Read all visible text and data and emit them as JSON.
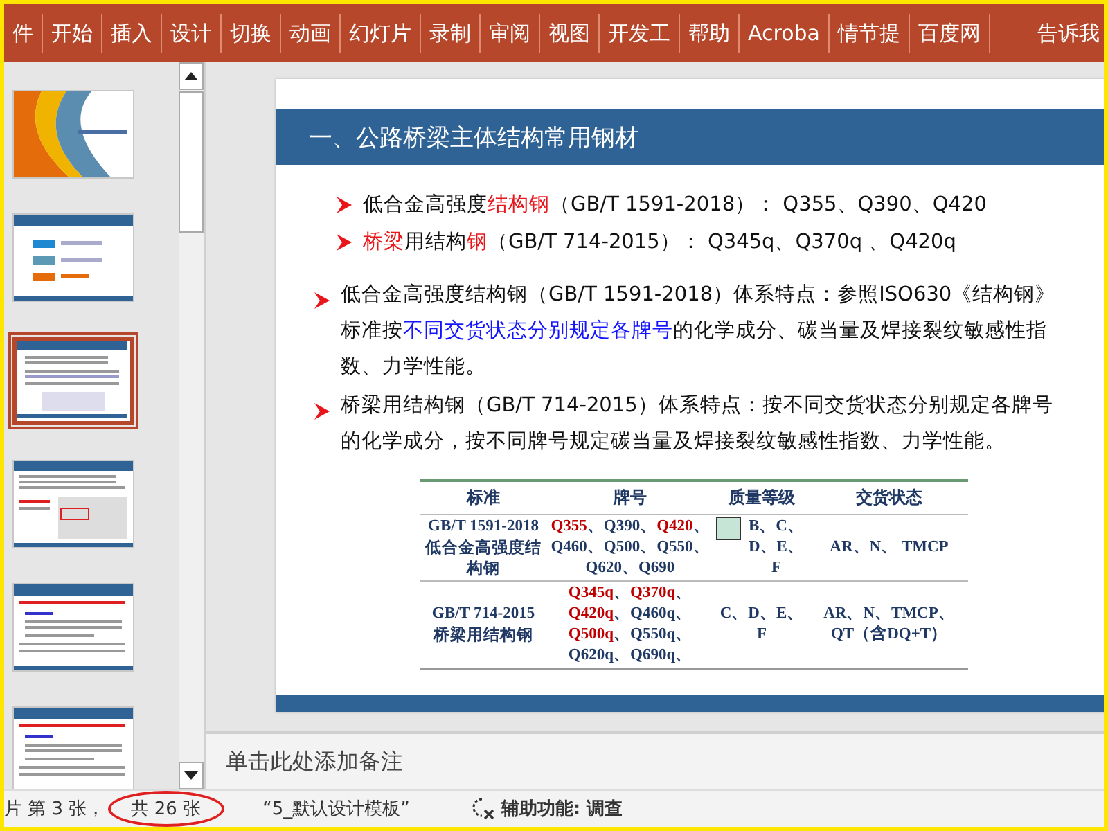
{
  "ribbon": {
    "tabs": [
      {
        "label": "件",
        "selected": false
      },
      {
        "label": "开始",
        "selected": false
      },
      {
        "label": "插入",
        "selected": false
      },
      {
        "label": "设计",
        "selected": false
      },
      {
        "label": "切换",
        "selected": false
      },
      {
        "label": "动画",
        "selected": false
      },
      {
        "label": "幻灯片",
        "selected": false
      },
      {
        "label": "录制",
        "selected": false
      },
      {
        "label": "审阅",
        "selected": false
      },
      {
        "label": "视图",
        "selected": false
      },
      {
        "label": "开发工",
        "selected": false
      },
      {
        "label": "帮助",
        "selected": false
      },
      {
        "label": "Acroba",
        "selected": false
      },
      {
        "label": "情节提",
        "selected": false
      },
      {
        "label": "百度网",
        "selected": false
      }
    ],
    "tell_me": "告诉我"
  },
  "thumbnails": [
    {
      "kind": "cover",
      "selected": false
    },
    {
      "kind": "agenda",
      "selected": false
    },
    {
      "kind": "content",
      "selected": true
    },
    {
      "kind": "table",
      "selected": false
    },
    {
      "kind": "text",
      "selected": false
    },
    {
      "kind": "text",
      "selected": false
    }
  ],
  "slide": {
    "title": "一、公路桥梁主体结构常用钢材",
    "bullets": [
      {
        "segments": [
          {
            "kind": "plain",
            "text": "低合金高强度"
          },
          {
            "kind": "emphasis",
            "text": "结构钢"
          },
          {
            "kind": "plain",
            "text": "（GB/T 1591-2018）： Q355、Q390、Q420"
          }
        ]
      },
      {
        "segments": [
          {
            "kind": "emphasis",
            "text": "桥梁"
          },
          {
            "kind": "plain",
            "text": "用结构"
          },
          {
            "kind": "emphasis",
            "text": "钢"
          },
          {
            "kind": "plain",
            "text": "（GB/T 714-2015）： Q345q、Q370q 、Q420q"
          }
        ]
      }
    ],
    "paragraphs": [
      {
        "segments": [
          {
            "kind": "plain",
            "text": "低合金高强度结构钢（GB/T 1591-2018）体系特点：参照ISO630《结构钢》标准按"
          },
          {
            "kind": "key",
            "text": "不同交货状态分别规定各牌号"
          },
          {
            "kind": "plain",
            "text": "的化学成分、碳当量及焊接裂纹敏感性指数、力学性能。"
          }
        ]
      },
      {
        "segments": [
          {
            "kind": "plain",
            "text": "桥梁用结构钢（GB/T 714-2015）体系特点：按不同交货状态分别规定各牌号的化学成分，按不同牌号规定碳当量及焊接裂纹敏感性指数、力学性能。"
          }
        ]
      }
    ],
    "table": {
      "columns": [
        "标准",
        "牌号",
        "质量等级",
        "交货状态"
      ],
      "rows": [
        {
          "standard": [
            "GB/T 1591-2018",
            "低合金高强度结构钢"
          ],
          "grades": [
            {
              "kind": "emphasis",
              "text": "Q355"
            },
            {
              "kind": "plain",
              "text": "、Q390、"
            },
            {
              "kind": "emphasis",
              "text": "Q420"
            },
            {
              "kind": "plain",
              "text": "、Q460、Q500、Q550、Q620、Q690"
            }
          ],
          "quality": "B、C、D、E、F",
          "swatch": true,
          "delivery": "AR、N、 TMCP"
        },
        {
          "standard": [
            "GB/T 714-2015",
            "桥梁用结构钢"
          ],
          "grades": [
            {
              "kind": "emphasis",
              "text": "Q345q"
            },
            {
              "kind": "plain",
              "text": "、"
            },
            {
              "kind": "emphasis",
              "text": "Q370q"
            },
            {
              "kind": "plain",
              "text": "、"
            },
            {
              "kind": "emphasis",
              "text": "Q420q"
            },
            {
              "kind": "plain",
              "text": "、Q460q、"
            },
            {
              "kind": "emphasis",
              "text": "Q500q"
            },
            {
              "kind": "plain",
              "text": "、Q550q、Q620q、Q690q、"
            }
          ],
          "quality": "C、D、E、F",
          "swatch": false,
          "delivery": "AR、N、TMCP、QT（含DQ+T）"
        }
      ]
    }
  },
  "notes": {
    "placeholder": "单击此处添加备注"
  },
  "status_bar": {
    "slide_position": "片 第 3 张，",
    "slide_total": "共 26 张",
    "theme": "“5_默认设计模板”",
    "accessibility": "辅助功能: 调查"
  }
}
